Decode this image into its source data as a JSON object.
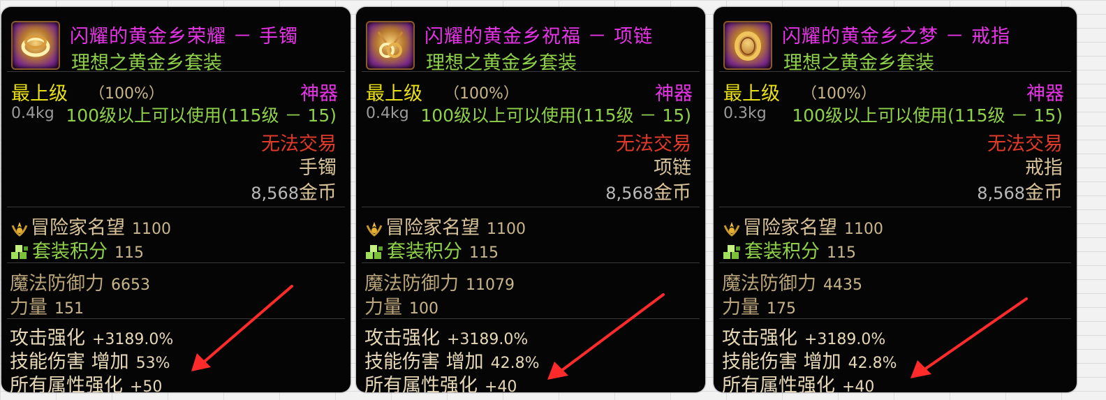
{
  "cards": [
    {
      "name": "闪耀的黄金乡荣耀 － 手镯",
      "set": "理想之黄金乡套装",
      "grade": "最上级",
      "grade_pct": "（100%）",
      "rarity": "神器",
      "weight": "0.4kg",
      "requirement": "100级以上可以使用(115级 － 15)",
      "trade": "无法交易",
      "slot": "手镯",
      "price": "8,568",
      "currency": "金币",
      "reputation_label": "冒险家名望",
      "reputation": "1100",
      "set_points_label": "套装积分",
      "set_points": "115",
      "stats": [
        {
          "label": "魔法防御力",
          "value": "6653"
        },
        {
          "label": "力量",
          "value": "151"
        }
      ],
      "bonuses": [
        {
          "label": "攻击强化",
          "value": "+3189.0%"
        },
        {
          "label": "技能伤害 增加",
          "value": "53%"
        },
        {
          "label": "所有属性强化",
          "value": "+50"
        }
      ]
    },
    {
      "name": "闪耀的黄金乡祝福 － 项链",
      "set": "理想之黄金乡套装",
      "grade": "最上级",
      "grade_pct": "（100%）",
      "rarity": "神器",
      "weight": "0.4kg",
      "requirement": "100级以上可以使用(115级 － 15)",
      "trade": "无法交易",
      "slot": "项链",
      "price": "8,568",
      "currency": "金币",
      "reputation_label": "冒险家名望",
      "reputation": "1100",
      "set_points_label": "套装积分",
      "set_points": "115",
      "stats": [
        {
          "label": "魔法防御力",
          "value": "11079"
        },
        {
          "label": "力量",
          "value": "100"
        }
      ],
      "bonuses": [
        {
          "label": "攻击强化",
          "value": "+3189.0%"
        },
        {
          "label": "技能伤害 增加",
          "value": "42.8%"
        },
        {
          "label": "所有属性强化",
          "value": "+40"
        }
      ]
    },
    {
      "name": "闪耀的黄金乡之梦 － 戒指",
      "set": "理想之黄金乡套装",
      "grade": "最上级",
      "grade_pct": "（100%）",
      "rarity": "神器",
      "weight": "0.3kg",
      "requirement": "100级以上可以使用(115级 － 15)",
      "trade": "无法交易",
      "slot": "戒指",
      "price": "8,568",
      "currency": "金币",
      "reputation_label": "冒险家名望",
      "reputation": "1100",
      "set_points_label": "套装积分",
      "set_points": "115",
      "stats": [
        {
          "label": "魔法防御力",
          "value": "4435"
        },
        {
          "label": "力量",
          "value": "175"
        }
      ],
      "bonuses": [
        {
          "label": "攻击强化",
          "value": "+3189.0%"
        },
        {
          "label": "技能伤害 增加",
          "value": "42.8%"
        },
        {
          "label": "所有属性强化",
          "value": "+40"
        }
      ]
    }
  ],
  "icons": {
    "bracelet": "bracelet-icon",
    "necklace": "necklace-icon",
    "ring": "ring-icon",
    "reputation": "laurel-icon",
    "set_points": "set-blocks-icon",
    "annotation": "red-arrow-icon"
  },
  "colors": {
    "item_name": "#e633e6",
    "set_name": "#8fd04a",
    "grade": "#e8e014",
    "untradeable": "#e23a2a",
    "annotation_arrow": "#ff2a2a"
  }
}
